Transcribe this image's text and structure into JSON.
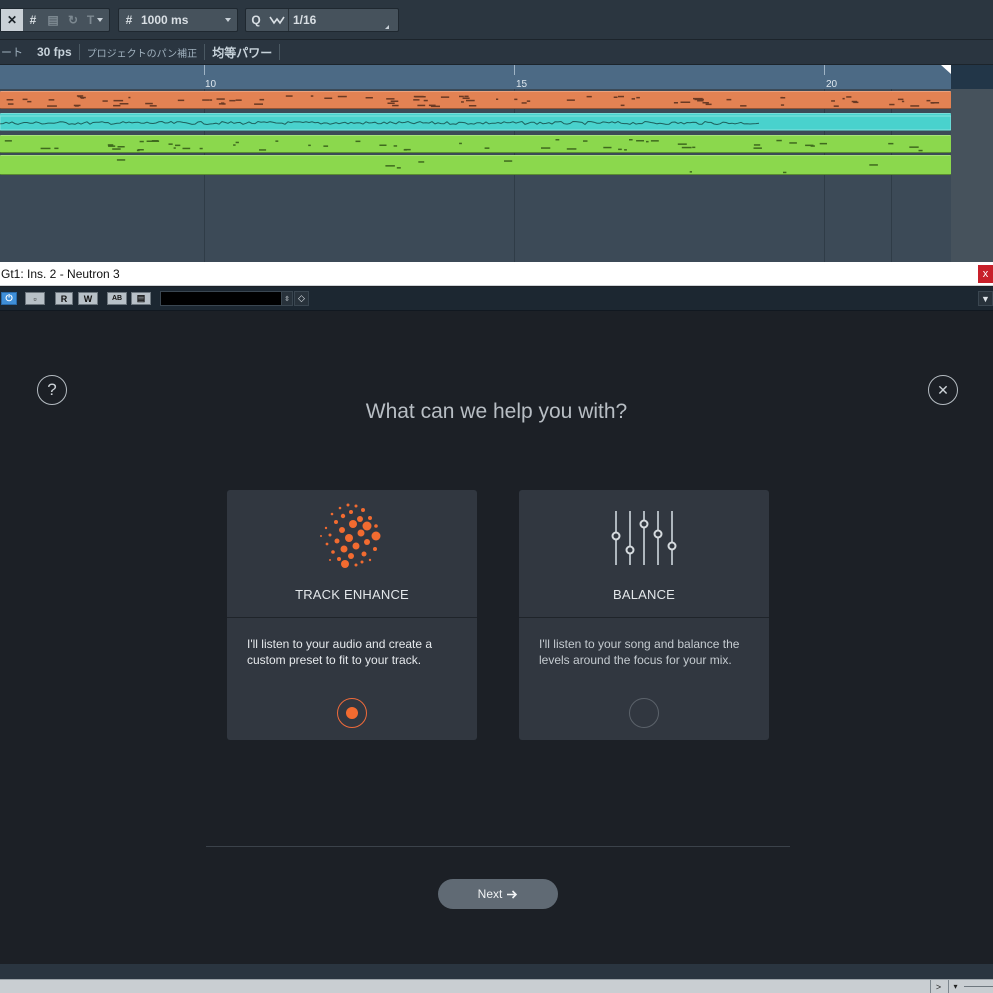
{
  "toolbar": {
    "snap_icon": "snap-x-icon",
    "grid_icon": "grid-icon",
    "nudge_value": "1000 ms",
    "quantize_label": "Q",
    "quantize_value": "1/16"
  },
  "infobar": {
    "left_label": "ート",
    "fps": "30 fps",
    "pan_law_label": "プロジェクトのパン補正",
    "pan_law_value": "均等パワー"
  },
  "ruler": {
    "bars": [
      "10",
      "15",
      "20"
    ]
  },
  "tracks": [
    {
      "color": "#e38253",
      "type": "midi"
    },
    {
      "color": "#49d2cd",
      "type": "audio"
    },
    {
      "color": "#8bd84d",
      "type": "midi"
    },
    {
      "color": "#8bd84d",
      "type": "midi"
    }
  ],
  "plugin_window": {
    "title": "Gt1: Ins. 2 - Neutron 3",
    "close_label": "x",
    "buttons": {
      "read": "R",
      "write": "W",
      "compare": "AB"
    }
  },
  "assistant": {
    "heading": "What can we help you with?",
    "help_icon": "question-mark-icon",
    "close_icon": "close-icon",
    "options": [
      {
        "title": "TRACK ENHANCE",
        "description": "I'll listen to your audio and create a custom preset to fit to your track.",
        "icon": "particle-sphere-icon",
        "selected": true
      },
      {
        "title": "BALANCE",
        "description": "I'll listen to your song and balance the levels around the focus for your mix.",
        "icon": "faders-icon",
        "selected": false
      }
    ],
    "next_label": "Next",
    "next_icon": "arrow-right-icon",
    "accent_color": "#f26b30"
  }
}
